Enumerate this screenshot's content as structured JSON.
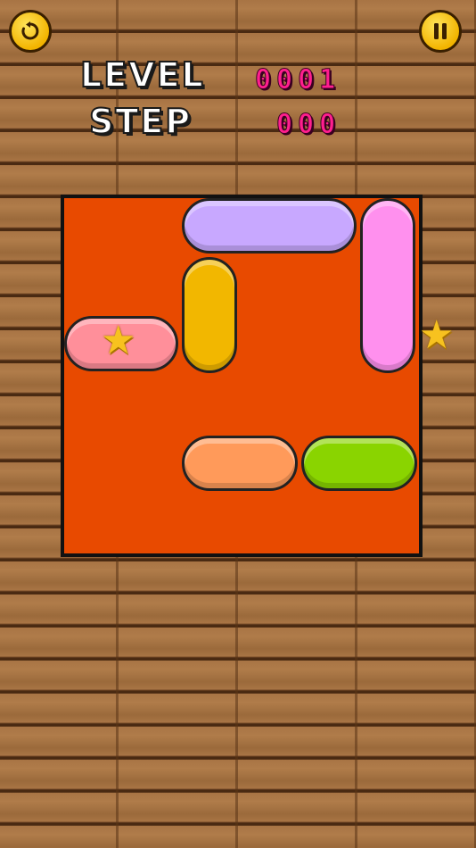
{
  "hud": {
    "level_label": "LEVEL",
    "level_value": "0001",
    "step_label": "STEP",
    "step_value": "000",
    "restart_icon": "restart-icon",
    "pause_icon": "pause-icon"
  },
  "board": {
    "background_color": "#e84a00",
    "blocks": [
      {
        "name": "purple-horizontal-block",
        "color": "#c8a8ff",
        "orientation": "horizontal"
      },
      {
        "name": "pink-vertical-block",
        "color": "#ff90ee",
        "orientation": "vertical"
      },
      {
        "name": "yellow-vertical-block",
        "color": "#f2b700",
        "orientation": "vertical"
      },
      {
        "name": "key-block-with-star",
        "color": "#ff8f9a",
        "orientation": "horizontal"
      },
      {
        "name": "orange-horizontal-block",
        "color": "#ff9a5a",
        "orientation": "horizontal"
      },
      {
        "name": "green-horizontal-block",
        "color": "#8ad400",
        "orientation": "horizontal"
      }
    ],
    "exit_icon": "star-icon"
  }
}
